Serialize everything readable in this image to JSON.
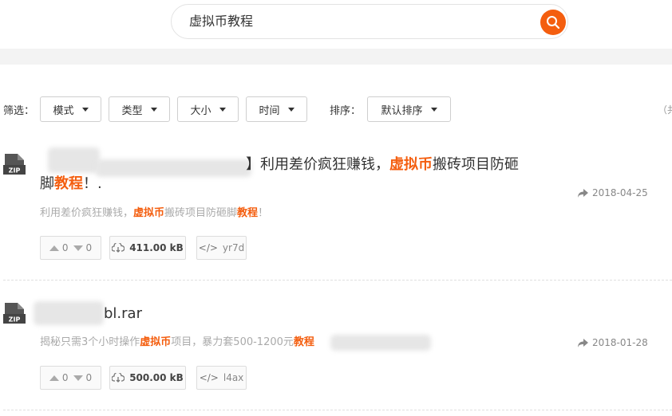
{
  "search": {
    "query": "虚拟币教程"
  },
  "filters": {
    "label": "筛选：",
    "mode": "模式",
    "type": "类型",
    "size": "大小",
    "time": "时间",
    "sort_label": "排序：",
    "sort_value": "默认排序",
    "total_hint": "（共"
  },
  "results": [
    {
      "file_type": "ZIP",
      "title_pre": "】利用差价疯狂赚钱，",
      "title_hl1": "虚拟币",
      "title_mid": "搬砖项目防砸",
      "title_line2_pre": "脚",
      "title_hl2": "教程",
      "title_post": "！.",
      "desc_pre": "利用差价疯狂赚钱，",
      "desc_hl1": "虚拟币",
      "desc_mid": "搬砖项目防砸脚",
      "desc_hl2": "教程",
      "desc_post": "！",
      "date": "2018-04-25",
      "up": "0",
      "down": "0",
      "size": "411.00 kB",
      "code": "yr7d"
    },
    {
      "file_type": "ZIP",
      "title_visible": "bl.rar",
      "desc_pre": "揭秘只需3个小时操作",
      "desc_hl1": "虚拟币",
      "desc_mid": "项目，暴力套500-1200元",
      "desc_hl2": "教程",
      "date": "2018-01-28",
      "up": "0",
      "down": "0",
      "size": "500.00 kB",
      "code": "l4ax"
    }
  ]
}
